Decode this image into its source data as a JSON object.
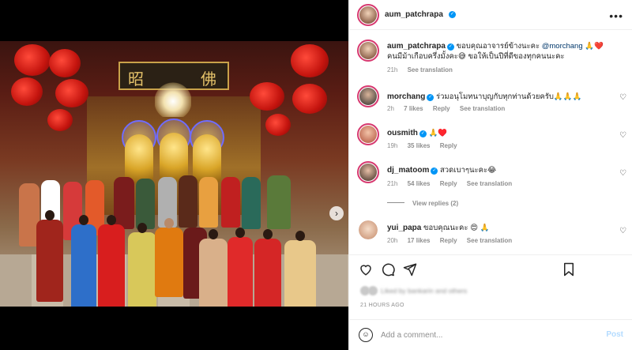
{
  "post": {
    "author": "aum_patchrapa",
    "menu_icon": "more-horizontal-icon"
  },
  "caption": {
    "username": "aum_patchrapa",
    "text_before": "ขอบคุณอาจารย์ข้างนะคะ ",
    "mention": "@morchang",
    "text_after": " 🙏❤️ คนมีม้าเกือบครึ่งมั้งคะ😅 ขอให้เป็นปีที่ดีของทุกคนนะคะ",
    "time": "21h",
    "see_translation": "See translation"
  },
  "comments": [
    {
      "username": "morchang",
      "verified": true,
      "text": "ร่วมอนุโมทนาบุญกับทุกท่านด้วยครับ🙏🙏🙏",
      "time": "2h",
      "likes": "7 likes",
      "reply": "Reply",
      "see_translation": "See translation"
    },
    {
      "username": "ousmith",
      "verified": true,
      "text": "🙏♥️",
      "time": "19h",
      "likes": "35 likes",
      "reply": "Reply",
      "see_translation": ""
    },
    {
      "username": "dj_matoom",
      "verified": true,
      "text": "สวดเบาๆนะคะ😂",
      "time": "21h",
      "likes": "54 likes",
      "reply": "Reply",
      "see_translation": "See translation"
    },
    {
      "username": "yui_papa",
      "verified": false,
      "text": "ขอบคุณนะคะ 😍 🙏",
      "time": "20h",
      "likes": "17 likes",
      "reply": "Reply",
      "see_translation": "See translation"
    }
  ],
  "view_replies": "View replies (2)",
  "likes_text": "Liked by bankarin and others",
  "timestamp": "21 HOURS AGO",
  "composer": {
    "placeholder": "Add a comment...",
    "post_label": "Post"
  },
  "colors": {
    "link": "#00376b",
    "verified": "#0095f6",
    "post_disabled": "#b3dbff",
    "story_ring": "#d7386f"
  }
}
